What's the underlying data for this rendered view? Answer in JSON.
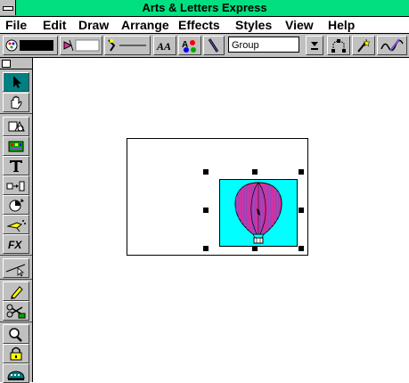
{
  "app": {
    "title": "Arts & Letters Express"
  },
  "menu": {
    "file": "File",
    "edit": "Edit",
    "draw": "Draw",
    "arrange": "Arrange",
    "effects": "Effects",
    "styles": "Styles",
    "view": "View",
    "help": "Help"
  },
  "toolbar": {
    "group_field": "Group",
    "icons": [
      "fill-color-icon",
      "fill-pattern-icon",
      "line-style-icon",
      "text-style-icon",
      "color-palette-icon",
      "pen-icon",
      "dropdown-arrow-icon",
      "edit-points-icon",
      "magic-wand-icon",
      "signature-icon"
    ]
  },
  "toolbox": {
    "tools": [
      "pointer-icon",
      "hand-icon",
      "shapes-icon",
      "clip-art-icon",
      "text-icon",
      "transform-icon",
      "rotate-icon",
      "airbrush-icon",
      "fx-icon",
      "line-icon",
      "pencil-icon",
      "scissors-icon",
      "zoom-icon",
      "lock-icon",
      "object-manager-icon"
    ],
    "selected": "pointer-icon",
    "fx_label": "FX"
  },
  "canvas": {
    "clip_art": "hot-air-balloon",
    "colors": {
      "picture_background": "#00ffff",
      "balloon": "#e0309a",
      "stripe": "#7c4cc8"
    }
  },
  "colors": {
    "titlebar": "#00e080",
    "chrome": "#c0c0c0",
    "selected_tool": "#008080"
  }
}
